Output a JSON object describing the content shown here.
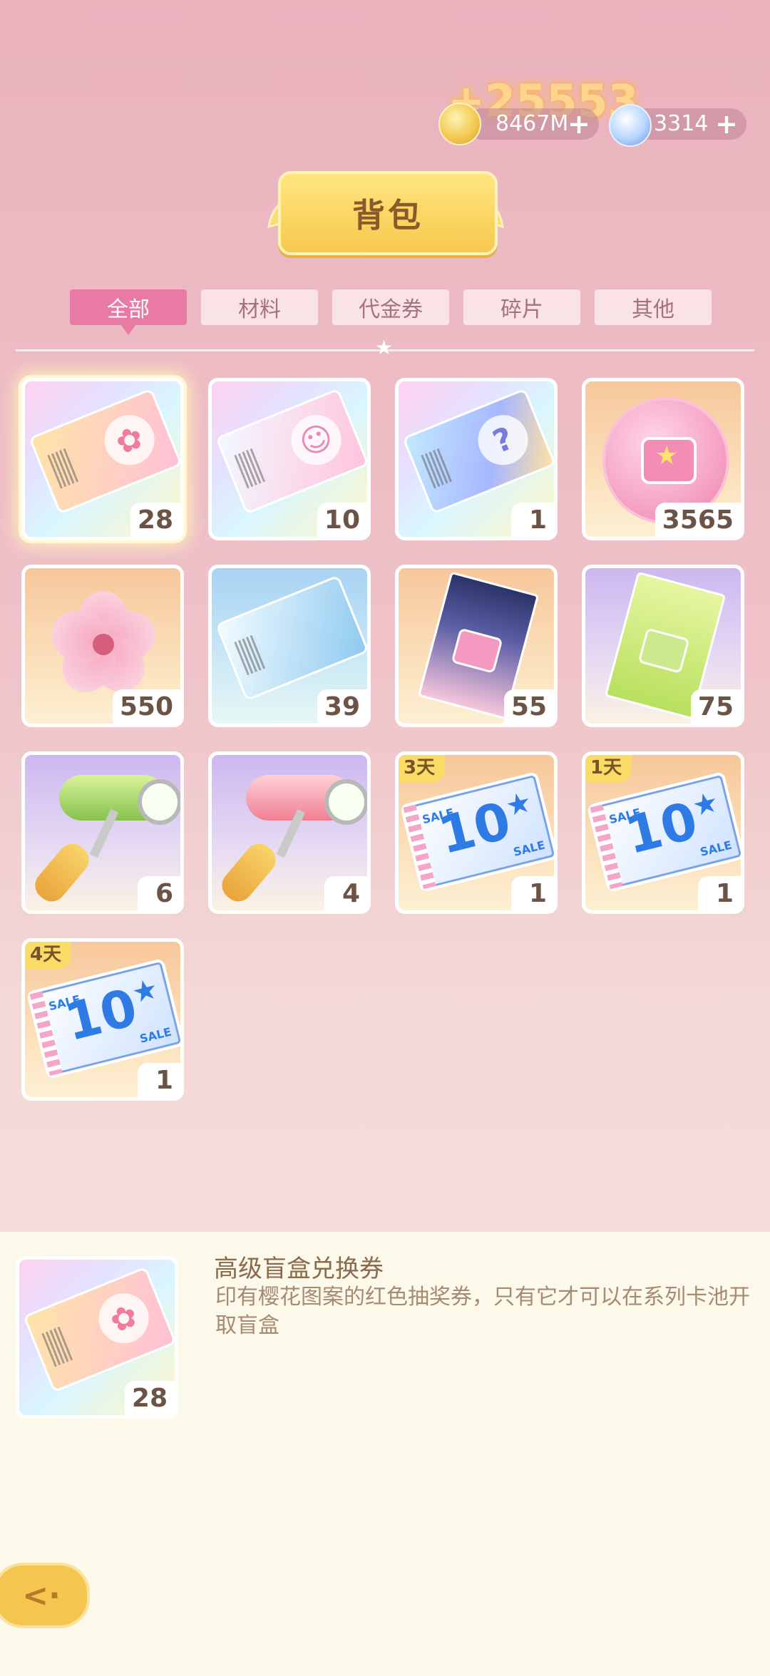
{
  "gain_popup": "+25553",
  "currencies": {
    "gold": {
      "value": "8467M",
      "plus": "+",
      "icon": "gold-coin-icon"
    },
    "crystal": {
      "value": "3314",
      "plus": "+",
      "icon": "snowflake-crystal-icon"
    }
  },
  "title": "背包",
  "tabs": [
    {
      "label": "全部",
      "active": true
    },
    {
      "label": "材料",
      "active": false
    },
    {
      "label": "代金券",
      "active": false
    },
    {
      "label": "碎片",
      "active": false
    },
    {
      "label": "其他",
      "active": false
    }
  ],
  "items": [
    {
      "art": "premium-ticket",
      "count": "28",
      "days": ""
    },
    {
      "art": "sakura-ticket",
      "count": "10",
      "days": ""
    },
    {
      "art": "mystery-ticket",
      "count": "1",
      "days": ""
    },
    {
      "art": "bag-coin",
      "count": "3565",
      "days": ""
    },
    {
      "art": "sakura-flower",
      "count": "550",
      "days": ""
    },
    {
      "art": "blue-ticket",
      "count": "39",
      "days": ""
    },
    {
      "art": "navy-long-ticket",
      "count": "55",
      "days": ""
    },
    {
      "art": "green-long-ticket",
      "count": "75",
      "days": ""
    },
    {
      "art": "green-roller",
      "count": "6",
      "days": ""
    },
    {
      "art": "pink-roller",
      "count": "4",
      "days": ""
    },
    {
      "art": "sale-voucher",
      "count": "1",
      "days": "3天"
    },
    {
      "art": "sale-voucher",
      "count": "1",
      "days": "1天"
    },
    {
      "art": "sale-voucher",
      "count": "1",
      "days": "4天"
    }
  ],
  "voucher": {
    "number": "10",
    "sale": "SALE",
    "star": "★"
  },
  "detail": {
    "name": "高级盲盒兑换券",
    "description": "印有樱花图案的红色抽奖券，只有它才可以在系列卡池开取盲盒",
    "count": "28"
  },
  "back_icon": "back-arrow-icon"
}
